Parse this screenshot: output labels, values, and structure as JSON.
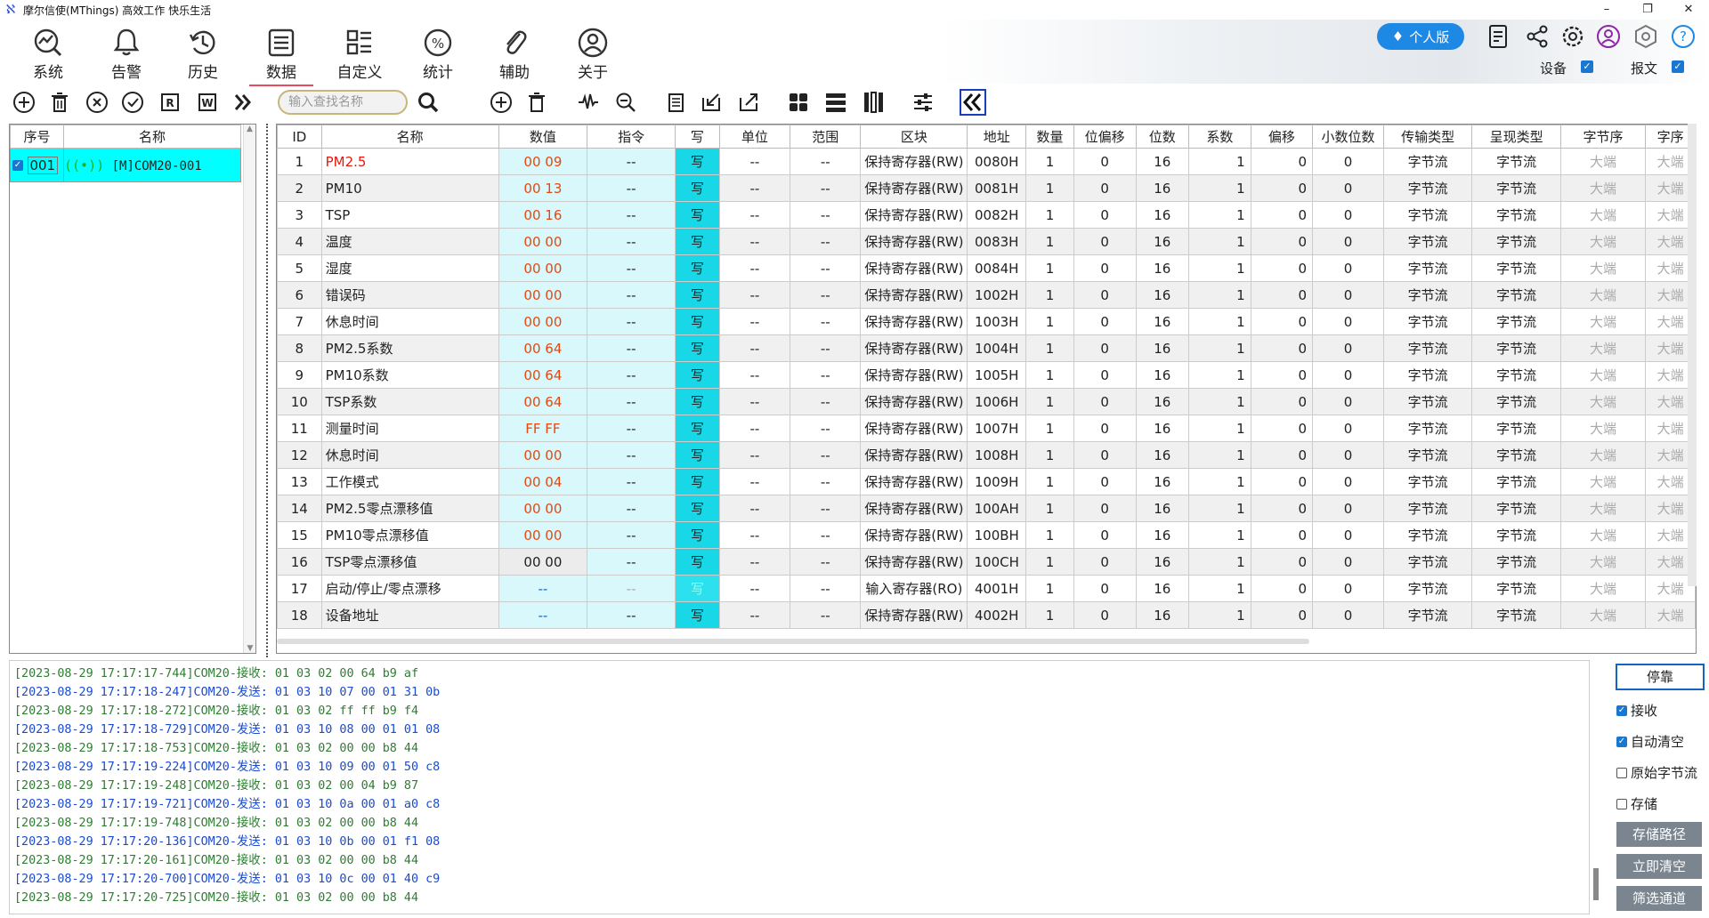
{
  "window": {
    "title": "摩尔信使(MThings) 高效工作 快乐生活",
    "min": "–",
    "max": "❐",
    "close": "✕"
  },
  "nav": [
    "系统",
    "告警",
    "历史",
    "数据",
    "自定义",
    "统计",
    "辅助",
    "关于"
  ],
  "nav_active": "数据",
  "vip_label": "个人版",
  "top_checks": {
    "device_label": "设备",
    "packet_label": "报文"
  },
  "search_placeholder": "输入查找名称",
  "left_table": {
    "headers": [
      "序号",
      "名称"
    ],
    "rows": [
      {
        "idx": "001",
        "name": "[M]COM20-001"
      }
    ]
  },
  "grid": {
    "headers": [
      "ID",
      "名称",
      "数值",
      "指令",
      "写",
      "单位",
      "范围",
      "区块",
      "地址",
      "数量",
      "位偏移",
      "位数",
      "系数",
      "偏移",
      "小数位数",
      "传输类型",
      "呈现类型",
      "字节序",
      "字序"
    ],
    "rows": [
      [
        "1",
        "PM2.5",
        "00 09",
        "--",
        "写",
        "--",
        "--",
        "保持寄存器(RW)",
        "0080H",
        "1",
        "0",
        "16",
        "1",
        "0",
        "0",
        "字节流",
        "字节流",
        "大端",
        "大端"
      ],
      [
        "2",
        "PM10",
        "00 13",
        "--",
        "写",
        "--",
        "--",
        "保持寄存器(RW)",
        "0081H",
        "1",
        "0",
        "16",
        "1",
        "0",
        "0",
        "字节流",
        "字节流",
        "大端",
        "大端"
      ],
      [
        "3",
        "TSP",
        "00 16",
        "--",
        "写",
        "--",
        "--",
        "保持寄存器(RW)",
        "0082H",
        "1",
        "0",
        "16",
        "1",
        "0",
        "0",
        "字节流",
        "字节流",
        "大端",
        "大端"
      ],
      [
        "4",
        "温度",
        "00 00",
        "--",
        "写",
        "--",
        "--",
        "保持寄存器(RW)",
        "0083H",
        "1",
        "0",
        "16",
        "1",
        "0",
        "0",
        "字节流",
        "字节流",
        "大端",
        "大端"
      ],
      [
        "5",
        "湿度",
        "00 00",
        "--",
        "写",
        "--",
        "--",
        "保持寄存器(RW)",
        "0084H",
        "1",
        "0",
        "16",
        "1",
        "0",
        "0",
        "字节流",
        "字节流",
        "大端",
        "大端"
      ],
      [
        "6",
        "错误码",
        "00 00",
        "--",
        "写",
        "--",
        "--",
        "保持寄存器(RW)",
        "1002H",
        "1",
        "0",
        "16",
        "1",
        "0",
        "0",
        "字节流",
        "字节流",
        "大端",
        "大端"
      ],
      [
        "7",
        "休息时间",
        "00 00",
        "--",
        "写",
        "--",
        "--",
        "保持寄存器(RW)",
        "1003H",
        "1",
        "0",
        "16",
        "1",
        "0",
        "0",
        "字节流",
        "字节流",
        "大端",
        "大端"
      ],
      [
        "8",
        "PM2.5系数",
        "00 64",
        "--",
        "写",
        "--",
        "--",
        "保持寄存器(RW)",
        "1004H",
        "1",
        "0",
        "16",
        "1",
        "0",
        "0",
        "字节流",
        "字节流",
        "大端",
        "大端"
      ],
      [
        "9",
        "PM10系数",
        "00 64",
        "--",
        "写",
        "--",
        "--",
        "保持寄存器(RW)",
        "1005H",
        "1",
        "0",
        "16",
        "1",
        "0",
        "0",
        "字节流",
        "字节流",
        "大端",
        "大端"
      ],
      [
        "10",
        "TSP系数",
        "00 64",
        "--",
        "写",
        "--",
        "--",
        "保持寄存器(RW)",
        "1006H",
        "1",
        "0",
        "16",
        "1",
        "0",
        "0",
        "字节流",
        "字节流",
        "大端",
        "大端"
      ],
      [
        "11",
        "测量时间",
        "FF FF",
        "--",
        "写",
        "--",
        "--",
        "保持寄存器(RW)",
        "1007H",
        "1",
        "0",
        "16",
        "1",
        "0",
        "0",
        "字节流",
        "字节流",
        "大端",
        "大端"
      ],
      [
        "12",
        "休息时间",
        "00 00",
        "--",
        "写",
        "--",
        "--",
        "保持寄存器(RW)",
        "1008H",
        "1",
        "0",
        "16",
        "1",
        "0",
        "0",
        "字节流",
        "字节流",
        "大端",
        "大端"
      ],
      [
        "13",
        "工作模式",
        "00 04",
        "--",
        "写",
        "--",
        "--",
        "保持寄存器(RW)",
        "1009H",
        "1",
        "0",
        "16",
        "1",
        "0",
        "0",
        "字节流",
        "字节流",
        "大端",
        "大端"
      ],
      [
        "14",
        "PM2.5零点漂移值",
        "00 00",
        "--",
        "写",
        "--",
        "--",
        "保持寄存器(RW)",
        "100AH",
        "1",
        "0",
        "16",
        "1",
        "0",
        "0",
        "字节流",
        "字节流",
        "大端",
        "大端"
      ],
      [
        "15",
        "PM10零点漂移值",
        "00 00",
        "--",
        "写",
        "--",
        "--",
        "保持寄存器(RW)",
        "100BH",
        "1",
        "0",
        "16",
        "1",
        "0",
        "0",
        "字节流",
        "字节流",
        "大端",
        "大端"
      ],
      [
        "16",
        "TSP零点漂移值",
        "00 00",
        "--",
        "写",
        "--",
        "--",
        "保持寄存器(RW)",
        "100CH",
        "1",
        "0",
        "16",
        "1",
        "0",
        "0",
        "字节流",
        "字节流",
        "大端",
        "大端"
      ],
      [
        "17",
        "启动/停止/零点漂移",
        "--",
        "--",
        "写",
        "--",
        "--",
        "输入寄存器(RO)",
        "4001H",
        "1",
        "0",
        "16",
        "1",
        "0",
        "0",
        "字节流",
        "字节流",
        "大端",
        "大端"
      ],
      [
        "18",
        "设备地址",
        "--",
        "--",
        "写",
        "--",
        "--",
        "保持寄存器(RW)",
        "4002H",
        "1",
        "0",
        "16",
        "1",
        "0",
        "0",
        "字节流",
        "字节流",
        "大端",
        "大端"
      ]
    ]
  },
  "log": [
    {
      "t": "rx",
      "text": "[2023-08-29 17:17:17-744]COM20-接收: 01 03 02 00 64 b9 af"
    },
    {
      "t": "tx",
      "text": "[2023-08-29 17:17:18-247]COM20-发送: 01 03 10 07 00 01 31 0b"
    },
    {
      "t": "rx",
      "text": "[2023-08-29 17:17:18-272]COM20-接收: 01 03 02 ff ff b9 f4"
    },
    {
      "t": "tx",
      "text": "[2023-08-29 17:17:18-729]COM20-发送: 01 03 10 08 00 01 01 08"
    },
    {
      "t": "rx",
      "text": "[2023-08-29 17:17:18-753]COM20-接收: 01 03 02 00 00 b8 44"
    },
    {
      "t": "tx",
      "text": "[2023-08-29 17:17:19-224]COM20-发送: 01 03 10 09 00 01 50 c8"
    },
    {
      "t": "rx",
      "text": "[2023-08-29 17:17:19-248]COM20-接收: 01 03 02 00 04 b9 87"
    },
    {
      "t": "tx",
      "text": "[2023-08-29 17:17:19-721]COM20-发送: 01 03 10 0a 00 01 a0 c8"
    },
    {
      "t": "rx",
      "text": "[2023-08-29 17:17:19-748]COM20-接收: 01 03 02 00 00 b8 44"
    },
    {
      "t": "tx",
      "text": "[2023-08-29 17:17:20-136]COM20-发送: 01 03 10 0b 00 01 f1 08"
    },
    {
      "t": "rx",
      "text": "[2023-08-29 17:17:20-161]COM20-接收: 01 03 02 00 00 b8 44"
    },
    {
      "t": "tx",
      "text": "[2023-08-29 17:17:20-700]COM20-发送: 01 03 10 0c 00 01 40 c9"
    },
    {
      "t": "rx",
      "text": "[2023-08-29 17:17:20-725]COM20-接收: 01 03 02 00 00 b8 44"
    }
  ],
  "right_controls": {
    "stop": "停靠",
    "checks": [
      {
        "label": "接收",
        "on": true
      },
      {
        "label": "自动清空",
        "on": true
      },
      {
        "label": "原始字节流",
        "on": false
      },
      {
        "label": "存储",
        "on": false
      }
    ],
    "buttons": [
      "存储路径",
      "立即清空",
      "筛选通道"
    ]
  }
}
